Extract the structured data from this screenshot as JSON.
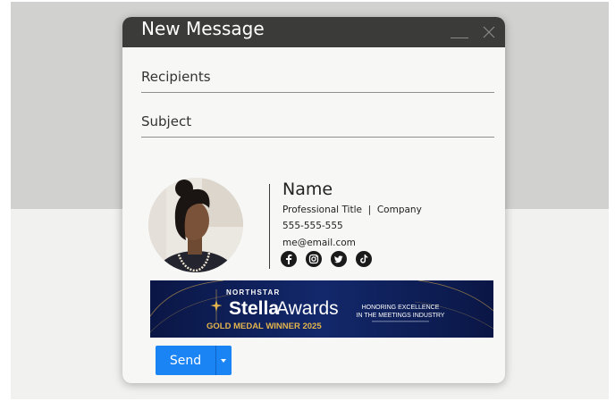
{
  "window": {
    "title": "New Message"
  },
  "fields": {
    "recipients_placeholder": "Recipients",
    "subject_placeholder": "Subject"
  },
  "signature": {
    "name": "Name",
    "title_company": "Professional Title  |  Company",
    "phone": "555-555-555",
    "email": "me@email.com",
    "socials": [
      "facebook-icon",
      "instagram-icon",
      "twitter-icon",
      "tiktok-icon"
    ]
  },
  "banner": {
    "eyebrow": "NORTHSTAR",
    "brand_a": "Stella",
    "brand_b": "Awards",
    "award": "GOLD MEDAL WINNER 2025",
    "tagline_1": "HONORING EXCELLENCE",
    "tagline_2": "IN THE MEETINGS INDUSTRY",
    "colors": {
      "background": "#0e1d54",
      "gold": "#e3b44c"
    }
  },
  "actions": {
    "send_label": "Send",
    "accent": "#1b84f5"
  }
}
